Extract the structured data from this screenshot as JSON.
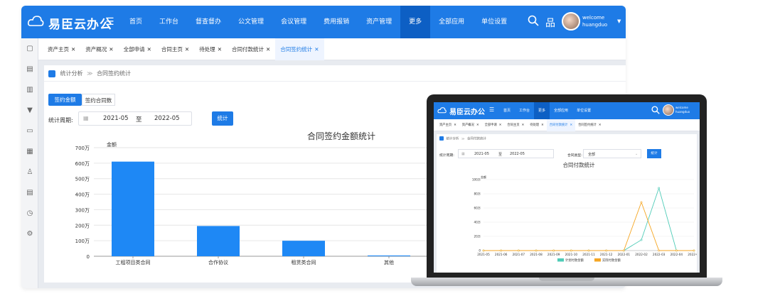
{
  "desktop": {
    "brand": "易臣云办公",
    "nav": [
      "首页",
      "工作台",
      "督查督办",
      "公文管理",
      "会议管理",
      "费用报销",
      "资产管理",
      "更多",
      "全部应用",
      "单位设置"
    ],
    "nav_active_index": 7,
    "welcome": "welcome",
    "username": "huangduo",
    "tabs": [
      {
        "label": "资产主页",
        "close": "✕"
      },
      {
        "label": "资产概况",
        "close": "✕"
      },
      {
        "label": "全部申请",
        "close": "✕"
      },
      {
        "label": "合同主页",
        "close": "✕"
      },
      {
        "label": "待处理",
        "close": "✕"
      },
      {
        "label": "合同付款统计",
        "close": "✕"
      },
      {
        "label": "合同签约统计",
        "close": "✕"
      }
    ],
    "active_tab_index": 6,
    "breadcrumb": {
      "section": "统计分析",
      "separator": "≫",
      "page": "合同签约统计"
    },
    "toggle_buttons": [
      "签约金额",
      "签约合同数"
    ],
    "period_label": "统计周期:",
    "date_start": "2021-05",
    "date_to": "至",
    "date_end": "2022-05",
    "stat_button": "统计",
    "sidebar_icons": [
      "doc-icon",
      "inbox-icon",
      "list-icon",
      "download-icon",
      "monitor-icon",
      "grid-icon",
      "user-icon",
      "file-icon",
      "clock-icon",
      "settings-icon"
    ]
  },
  "laptop": {
    "brand": "易臣云办公",
    "nav": [
      "首页",
      "工作台",
      "更多",
      "全部应用",
      "单位设置"
    ],
    "nav_active_index": 2,
    "welcome": "welcome",
    "username": "huangduo",
    "tabs": [
      {
        "label": "资产主页",
        "close": "✕"
      },
      {
        "label": "资产概况",
        "close": "✕"
      },
      {
        "label": "全部申请",
        "close": "✕"
      },
      {
        "label": "合同主页",
        "close": "✕"
      },
      {
        "label": "待处理",
        "close": "✕"
      },
      {
        "label": "合同付款统计",
        "close": "✕"
      },
      {
        "label": "合同签约统计",
        "close": "✕"
      }
    ],
    "active_tab_index": 5,
    "breadcrumb": {
      "section": "统计分析",
      "separator": "≫",
      "page": "合同付款统计"
    },
    "period_label": "统计周期:",
    "date_start": "2021-05",
    "date_to": "至",
    "date_end": "2022-05",
    "type_label": "合同类型:",
    "type_value": "全部",
    "stat_button": "统计"
  },
  "chart_data": [
    {
      "type": "bar",
      "title": "合同签约金额统计",
      "ylabel": "金额",
      "categories": [
        "工程项目类合同",
        "合作协议",
        "租赁类合同",
        "其他"
      ],
      "values": [
        610,
        195,
        100,
        5
      ],
      "yticks": [
        "0",
        "100万",
        "200万",
        "300万",
        "400万",
        "500万",
        "600万",
        "700万"
      ],
      "ylim": [
        0,
        700
      ],
      "unit": "万",
      "color": "#1e88f5"
    },
    {
      "type": "line",
      "title": "合同付款统计",
      "ylabel": "金额",
      "x": [
        "2021-05",
        "2021-06",
        "2021-07",
        "2021-08",
        "2021-09",
        "2021-10",
        "2021-11",
        "2021-12",
        "2022-01",
        "2022-02",
        "2022-03",
        "2022-04",
        "2022-05"
      ],
      "yticks": [
        "0",
        "20万",
        "40万",
        "60万",
        "80万",
        "100万"
      ],
      "ylim": [
        0,
        100
      ],
      "series": [
        {
          "name": "计划付款金额",
          "color": "#4ecbb7",
          "values": [
            0,
            0,
            0,
            0,
            0,
            0,
            0,
            0,
            0,
            15,
            88,
            0,
            0
          ]
        },
        {
          "name": "实际付款金额",
          "color": "#f5a623",
          "values": [
            0,
            0,
            0,
            0,
            0,
            0,
            0,
            0,
            0,
            68,
            0,
            0,
            0
          ]
        }
      ],
      "legend": "bottom"
    }
  ]
}
